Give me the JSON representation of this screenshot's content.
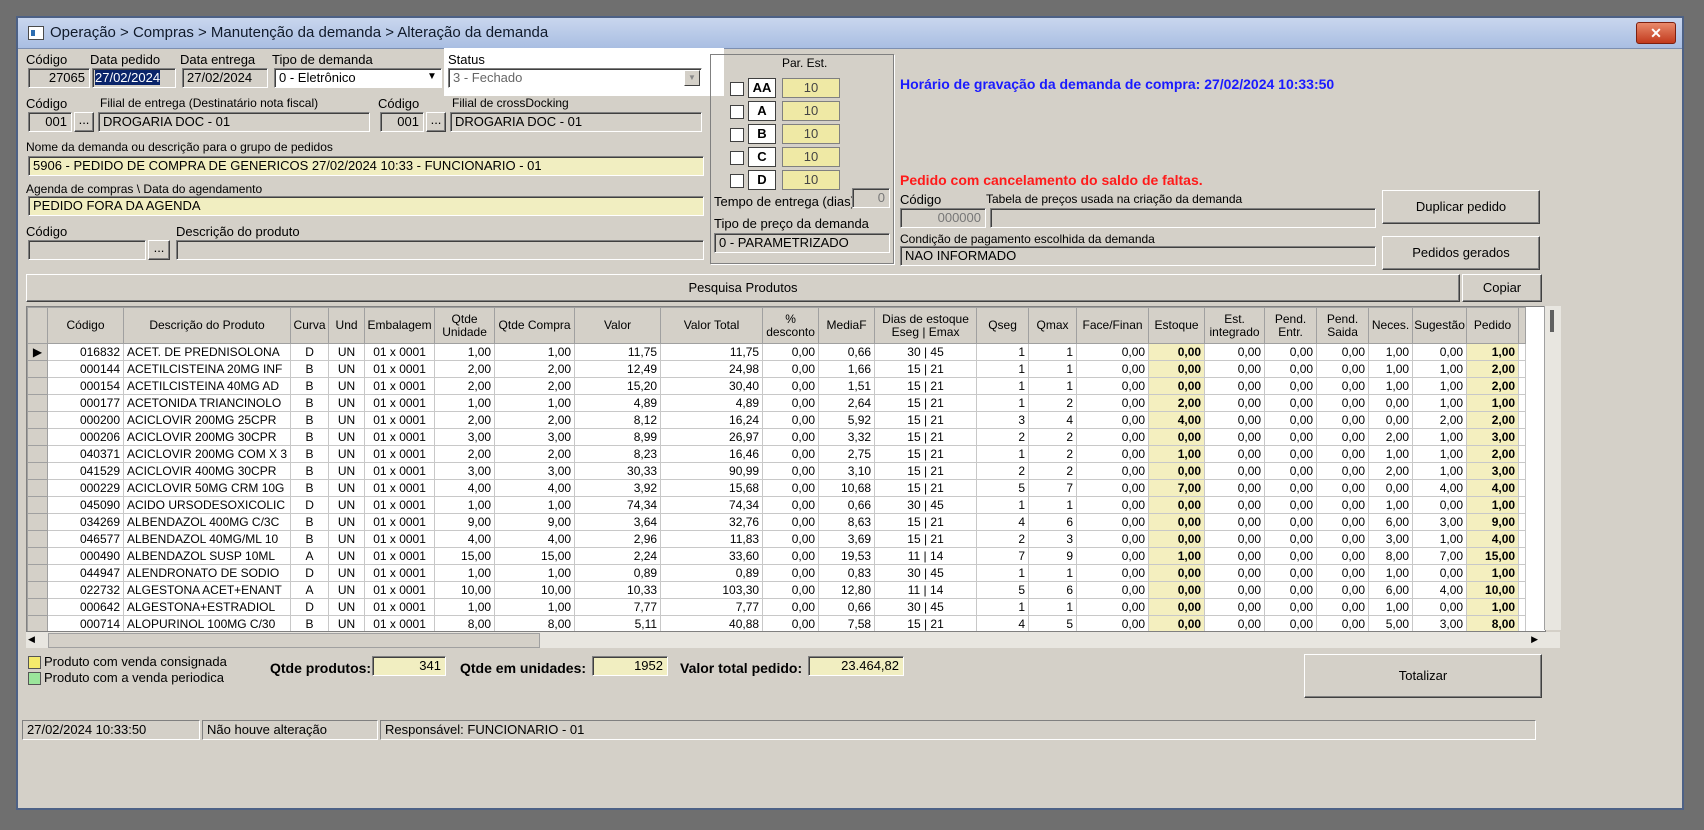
{
  "window": {
    "title": "Operação > Compras > Manutenção da demanda > Alteração da demanda",
    "close": "✕"
  },
  "header": {
    "codigo_label": "Código",
    "codigo": "27065",
    "data_pedido_label": "Data pedido",
    "data_pedido": "27/02/2024",
    "data_entrega_label": "Data entrega",
    "data_entrega": "27/02/2024",
    "tipo_demanda_label": "Tipo de demanda",
    "tipo_demanda": "0 - Eletrônico",
    "status_label": "Status",
    "status": "3 - Fechado",
    "codigo2_label": "Código",
    "codigo2": "001",
    "filial_label": "Filial de entrega (Destinatário nota fiscal)",
    "filial": "DROGARIA DOC - 01",
    "codigo3_label": "Código",
    "codigo3": "001",
    "crossdocking_label": "Filial de crossDocking",
    "crossdocking": "DROGARIA DOC - 01",
    "nome_label": "Nome da demanda ou descrição para o grupo de pedidos",
    "nome": "5906 - PEDIDO DE COMPRA DE GENERICOS 27/02/2024 10:33 - FUNCIONARIO - 01",
    "agenda_label": "Agenda de compras \\ Data do agendamento",
    "agenda": "PEDIDO FORA DA AGENDA",
    "codigo_prod_label": "Código",
    "descricao_prod_label": "Descrição do produto",
    "ellipsis": "..."
  },
  "par_est": {
    "label": "Par. Est.",
    "rows": [
      {
        "curva": "AA",
        "valor": "10"
      },
      {
        "curva": "A",
        "valor": "10"
      },
      {
        "curva": "B",
        "valor": "10"
      },
      {
        "curva": "C",
        "valor": "10"
      },
      {
        "curva": "D",
        "valor": "10"
      }
    ],
    "tempo_label": "Tempo de entrega (dias)",
    "tempo": "0",
    "tipo_preco_label": "Tipo de preço da demanda",
    "tipo_preco": "0 - PARAMETRIZADO"
  },
  "right": {
    "horario": "Horário de gravação da demanda de compra: 27/02/2024 10:33:50",
    "cancelamento": "Pedido com cancelamento do saldo de faltas.",
    "codigo_label": "Código",
    "codigo": "000000",
    "tabela_label": "Tabela de preços usada na criação da demanda",
    "tabela": "",
    "condicao_label": "Condição de pagamento escolhida da demanda",
    "condicao": "NAO INFORMADO",
    "duplicar": "Duplicar pedido",
    "gerados": "Pedidos gerados"
  },
  "search": {
    "pesquisa": "Pesquisa Produtos",
    "copiar": "Copiar"
  },
  "colors": {
    "accent": "#0a246a",
    "blue_text": "#1a1aff",
    "red_text": "#ff1a1a",
    "yellow": "#f1eec1"
  },
  "grid": {
    "headers": [
      "Código",
      "Descrição do Produto",
      "Curva",
      "Und",
      "Embalagem",
      "Qtde Unidade",
      "Qtde Compra",
      "Valor",
      "Valor Total",
      "% desconto",
      "MediaF",
      "Dias de estoque Eseg | Emax",
      "Qseg",
      "Qmax",
      "Face/Finan",
      "Estoque",
      "Est. integrado",
      "Pend. Entr.",
      "Pend. Saida",
      "Neces.",
      "Sugestão",
      "Pedido"
    ],
    "rows": [
      [
        "016832",
        "ACET. DE PREDNISOLONA",
        "D",
        "UN",
        "01 x 0001",
        "1,00",
        "1,00",
        "11,75",
        "11,75",
        "0,00",
        "0,66",
        "30  |  45",
        "1",
        "1",
        "0,00",
        "0,00",
        "0,00",
        "0,00",
        "0,00",
        "1,00",
        "0,00",
        "1,00"
      ],
      [
        "000144",
        "ACETILCISTEINA 20MG INF",
        "B",
        "UN",
        "01 x 0001",
        "2,00",
        "2,00",
        "12,49",
        "24,98",
        "0,00",
        "1,66",
        "15  |  21",
        "1",
        "1",
        "0,00",
        "0,00",
        "0,00",
        "0,00",
        "0,00",
        "1,00",
        "1,00",
        "2,00"
      ],
      [
        "000154",
        "ACETILCISTEINA 40MG AD",
        "B",
        "UN",
        "01 x 0001",
        "2,00",
        "2,00",
        "15,20",
        "30,40",
        "0,00",
        "1,51",
        "15  |  21",
        "1",
        "1",
        "0,00",
        "0,00",
        "0,00",
        "0,00",
        "0,00",
        "1,00",
        "1,00",
        "2,00"
      ],
      [
        "000177",
        "ACETONIDA TRIANCINOLO",
        "B",
        "UN",
        "01 x 0001",
        "1,00",
        "1,00",
        "4,89",
        "4,89",
        "0,00",
        "2,64",
        "15  |  21",
        "1",
        "2",
        "0,00",
        "2,00",
        "0,00",
        "0,00",
        "0,00",
        "0,00",
        "1,00",
        "1,00"
      ],
      [
        "000200",
        "ACICLOVIR 200MG 25CPR",
        "B",
        "UN",
        "01 x 0001",
        "2,00",
        "2,00",
        "8,12",
        "16,24",
        "0,00",
        "5,92",
        "15  |  21",
        "3",
        "4",
        "0,00",
        "4,00",
        "0,00",
        "0,00",
        "0,00",
        "0,00",
        "2,00",
        "2,00"
      ],
      [
        "000206",
        "ACICLOVIR 200MG 30CPR",
        "B",
        "UN",
        "01 x 0001",
        "3,00",
        "3,00",
        "8,99",
        "26,97",
        "0,00",
        "3,32",
        "15  |  21",
        "2",
        "2",
        "0,00",
        "0,00",
        "0,00",
        "0,00",
        "0,00",
        "2,00",
        "1,00",
        "3,00"
      ],
      [
        "040371",
        "ACICLOVIR 200MG COM X 3",
        "B",
        "UN",
        "01 x 0001",
        "2,00",
        "2,00",
        "8,23",
        "16,46",
        "0,00",
        "2,75",
        "15  |  21",
        "1",
        "2",
        "0,00",
        "1,00",
        "0,00",
        "0,00",
        "0,00",
        "1,00",
        "1,00",
        "2,00"
      ],
      [
        "041529",
        "ACICLOVIR 400MG 30CPR",
        "B",
        "UN",
        "01 x 0001",
        "3,00",
        "3,00",
        "30,33",
        "90,99",
        "0,00",
        "3,10",
        "15  |  21",
        "2",
        "2",
        "0,00",
        "0,00",
        "0,00",
        "0,00",
        "0,00",
        "2,00",
        "1,00",
        "3,00"
      ],
      [
        "000229",
        "ACICLOVIR 50MG CRM 10G",
        "B",
        "UN",
        "01 x 0001",
        "4,00",
        "4,00",
        "3,92",
        "15,68",
        "0,00",
        "10,68",
        "15  |  21",
        "5",
        "7",
        "0,00",
        "7,00",
        "0,00",
        "0,00",
        "0,00",
        "0,00",
        "4,00",
        "4,00"
      ],
      [
        "045090",
        "ACIDO URSODESOXICOLIC",
        "D",
        "UN",
        "01 x 0001",
        "1,00",
        "1,00",
        "74,34",
        "74,34",
        "0,00",
        "0,66",
        "30  |  45",
        "1",
        "1",
        "0,00",
        "0,00",
        "0,00",
        "0,00",
        "0,00",
        "1,00",
        "0,00",
        "1,00"
      ],
      [
        "034269",
        "ALBENDAZOL 400MG C/3C",
        "B",
        "UN",
        "01 x 0001",
        "9,00",
        "9,00",
        "3,64",
        "32,76",
        "0,00",
        "8,63",
        "15  |  21",
        "4",
        "6",
        "0,00",
        "0,00",
        "0,00",
        "0,00",
        "0,00",
        "6,00",
        "3,00",
        "9,00"
      ],
      [
        "046577",
        "ALBENDAZOL 40MG/ML 10",
        "B",
        "UN",
        "01 x 0001",
        "4,00",
        "4,00",
        "2,96",
        "11,83",
        "0,00",
        "3,69",
        "15  |  21",
        "2",
        "3",
        "0,00",
        "0,00",
        "0,00",
        "0,00",
        "0,00",
        "3,00",
        "1,00",
        "4,00"
      ],
      [
        "000490",
        "ALBENDAZOL SUSP 10ML",
        "A",
        "UN",
        "01 x 0001",
        "15,00",
        "15,00",
        "2,24",
        "33,60",
        "0,00",
        "19,53",
        "11  |  14",
        "7",
        "9",
        "0,00",
        "1,00",
        "0,00",
        "0,00",
        "0,00",
        "8,00",
        "7,00",
        "15,00"
      ],
      [
        "044947",
        "ALENDRONATO DE SODIO",
        "D",
        "UN",
        "01 x 0001",
        "1,00",
        "1,00",
        "0,89",
        "0,89",
        "0,00",
        "0,83",
        "30  |  45",
        "1",
        "1",
        "0,00",
        "0,00",
        "0,00",
        "0,00",
        "0,00",
        "1,00",
        "0,00",
        "1,00"
      ],
      [
        "022732",
        "ALGESTONA ACET+ENANT",
        "A",
        "UN",
        "01 x 0001",
        "10,00",
        "10,00",
        "10,33",
        "103,30",
        "0,00",
        "12,80",
        "11  |  14",
        "5",
        "6",
        "0,00",
        "0,00",
        "0,00",
        "0,00",
        "0,00",
        "6,00",
        "4,00",
        "10,00"
      ],
      [
        "000642",
        "ALGESTONA+ESTRADIOL",
        "D",
        "UN",
        "01 x 0001",
        "1,00",
        "1,00",
        "7,77",
        "7,77",
        "0,00",
        "0,66",
        "30  |  45",
        "1",
        "1",
        "0,00",
        "0,00",
        "0,00",
        "0,00",
        "0,00",
        "1,00",
        "0,00",
        "1,00"
      ],
      [
        "000714",
        "ALOPURINOL 100MG C/30",
        "B",
        "UN",
        "01 x 0001",
        "8,00",
        "8,00",
        "5,11",
        "40,88",
        "0,00",
        "7,58",
        "15  |  21",
        "4",
        "5",
        "0,00",
        "0,00",
        "0,00",
        "0,00",
        "0,00",
        "5,00",
        "3,00",
        "8,00"
      ]
    ]
  },
  "footer": {
    "legend1": "Produto com venda consignada",
    "legend2": "Produto com a venda periodica",
    "qtde_produtos_label": "Qtde produtos:",
    "qtde_produtos": "341",
    "qtde_unidades_label": "Qtde em unidades:",
    "qtde_unidades": "1952",
    "valor_total_label": "Valor total pedido:",
    "valor_total": "23.464,82",
    "totalizar": "Totalizar"
  },
  "status_bar": {
    "datetime": "27/02/2024 10:33:50",
    "alteracao": "Não houve alteração",
    "responsavel": "Responsável: FUNCIONARIO - 01"
  }
}
